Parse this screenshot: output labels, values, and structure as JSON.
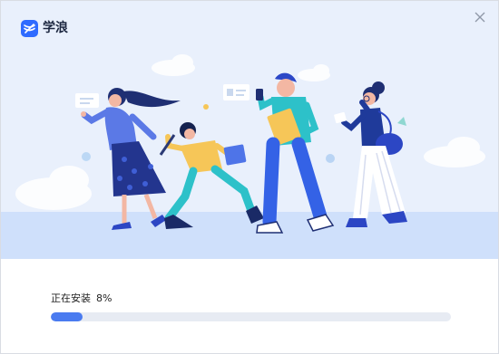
{
  "app": {
    "name": "学浪",
    "logo_icon": "xuelang-logo-icon",
    "close_icon": "close-icon"
  },
  "colors": {
    "accent": "#4a7bf0",
    "brand": "#2f6bff",
    "hero_bg": "#e9f0fc",
    "track": "#e7ebf3"
  },
  "install": {
    "status_text": "正在安装",
    "percent_text": "8%",
    "progress": 0.08
  },
  "illustration": {
    "subject": "people-walking-illustration"
  }
}
